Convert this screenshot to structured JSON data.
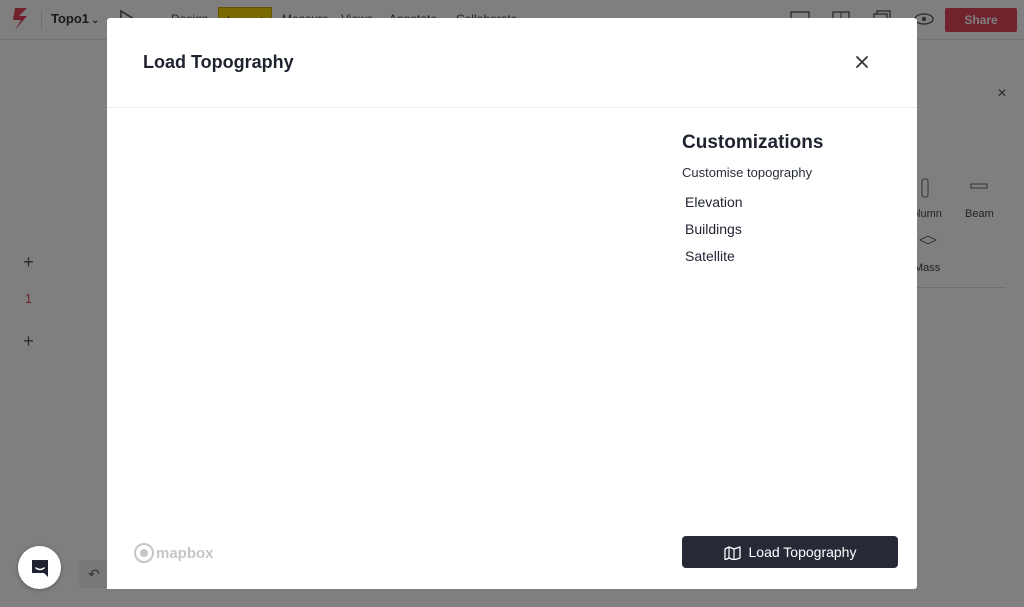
{
  "app": {
    "project_name": "Topo1",
    "nav_tabs": [
      "Design",
      "Layout",
      "Measure",
      "Views",
      "Annotate",
      "Collaborate"
    ],
    "active_tab": "Layout",
    "share_label": "Share",
    "left_tools": [
      "+",
      "1",
      "+"
    ],
    "side_panel": {
      "items": [
        "Column",
        "Beam",
        "Mass"
      ]
    },
    "colors": {
      "share": "#e0455a",
      "active_tab": "#f5d000"
    }
  },
  "modal": {
    "title": "Load Topography",
    "close_icon": "close-icon",
    "customizations": {
      "heading": "Customizations",
      "subheading": "Customise topography",
      "options": [
        "Elevation",
        "Buildings",
        "Satellite"
      ]
    },
    "map_attribution": "mapbox",
    "load_button_label": "Load Topography",
    "load_button_icon": "map-icon",
    "colors": {
      "button_bg": "#262a37",
      "overlay": "rgba(0,0,0,0.5)"
    }
  },
  "chat": {
    "icon": "chat-icon"
  }
}
